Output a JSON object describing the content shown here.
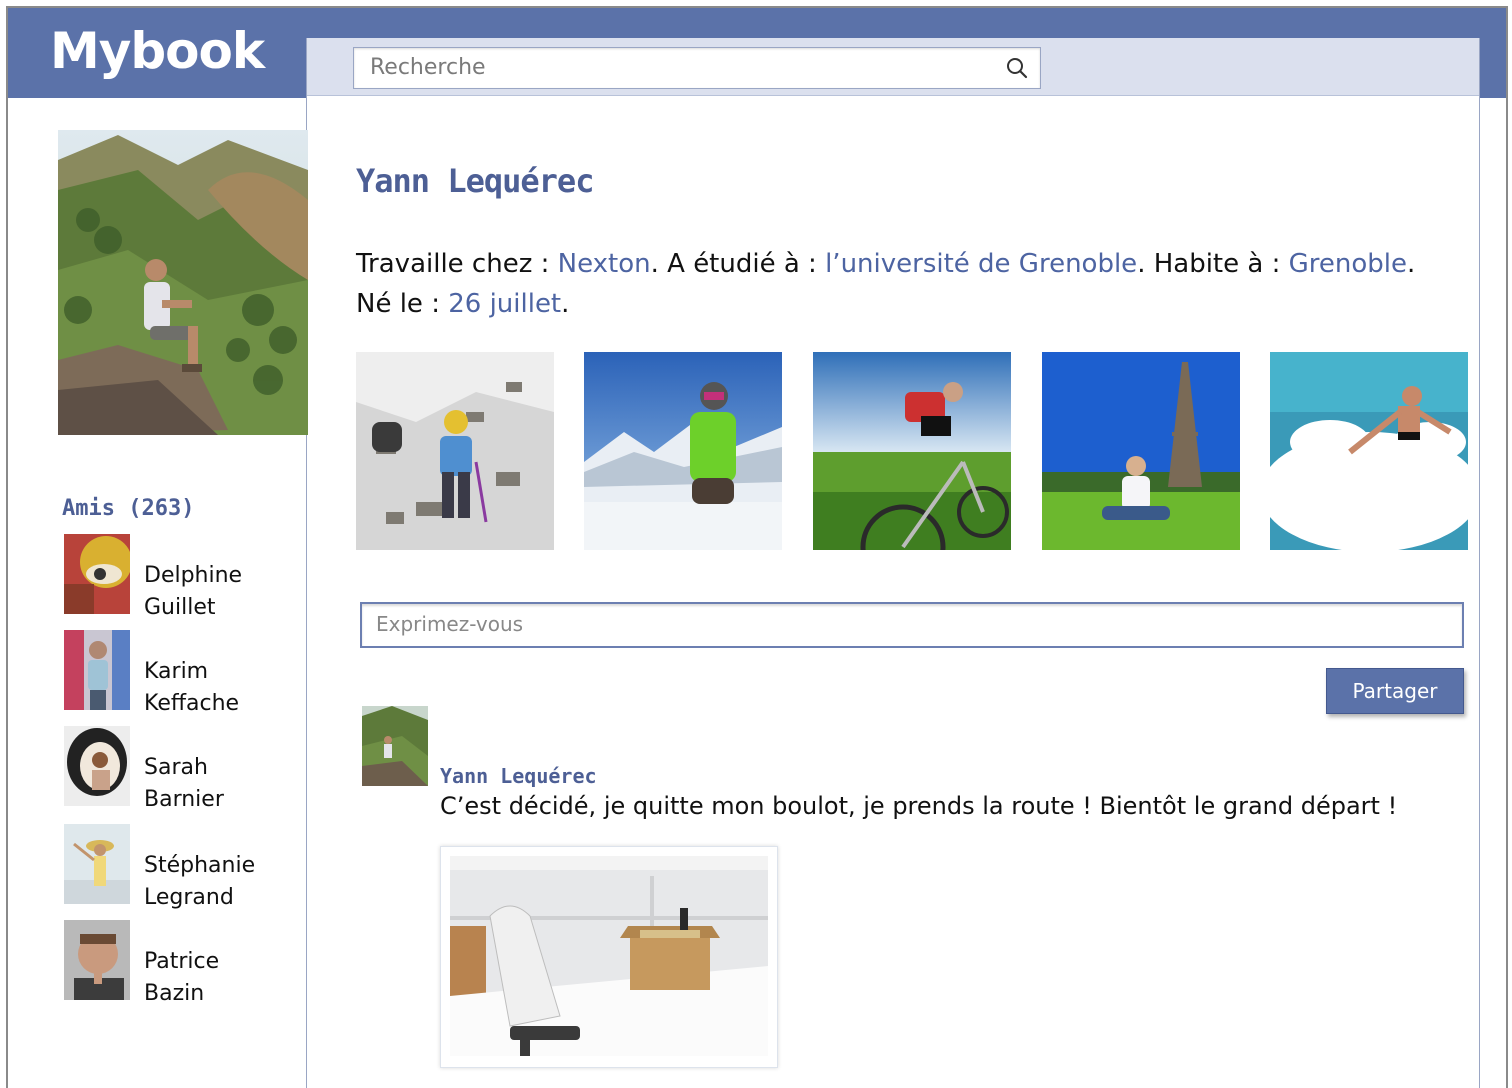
{
  "app": {
    "logo": "Mybook"
  },
  "search": {
    "placeholder": "Recherche"
  },
  "profile": {
    "name": "Yann Lequérec",
    "info": {
      "work_label": "Travaille chez : ",
      "work": "Nexton",
      "study_label": ". A étudié à : ",
      "study": "l’université de Grenoble",
      "city_label": ". Habite à : ",
      "city": "Grenoble",
      "dot1": ".",
      "birth_label": "Né le : ",
      "birth": "26 juillet",
      "dot2": "."
    }
  },
  "friends": {
    "title": "Amis (263)",
    "items": [
      {
        "first": "Delphine",
        "last": "Guillet"
      },
      {
        "first": "Karim",
        "last": "Keffache"
      },
      {
        "first": "Sarah",
        "last": "Barnier"
      },
      {
        "first": "Stéphanie",
        "last": "Legrand"
      },
      {
        "first": "Patrice",
        "last": "Bazin"
      }
    ]
  },
  "composer": {
    "placeholder": "Exprimez-vous",
    "share_label": "Partager"
  },
  "post": {
    "author": "Yann Lequérec",
    "text": "C’est décidé, je quitte mon boulot, je prends la route ! Bientôt le grand départ !"
  },
  "colors": {
    "brand": "#5b72a9",
    "link": "#4d64a2",
    "title": "#4d5f95"
  }
}
